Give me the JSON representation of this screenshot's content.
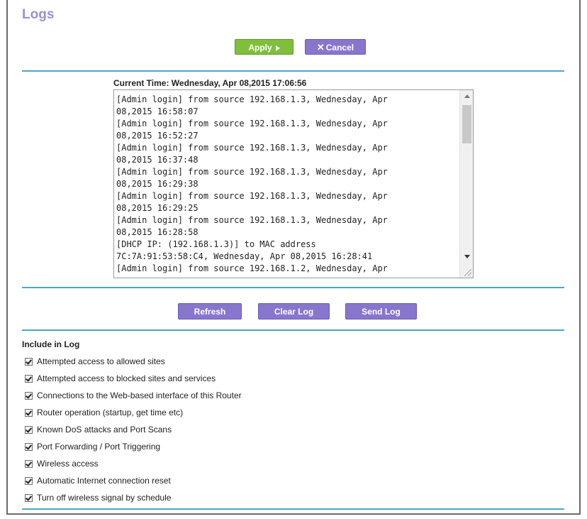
{
  "page": {
    "title": "Logs"
  },
  "actions": {
    "apply_label": "Apply",
    "cancel_label": "Cancel",
    "apply_icon": "arrow-right-icon",
    "cancel_icon": "x-icon"
  },
  "log": {
    "current_time": "Current Time: Wednesday, Apr 08,2015 17:06:56",
    "text": "[Admin login] from source 192.168.1.3, Wednesday, Apr\n08,2015 16:58:07\n[Admin login] from source 192.168.1.3, Wednesday, Apr\n08,2015 16:52:27\n[Admin login] from source 192.168.1.3, Wednesday, Apr\n08,2015 16:37:48\n[Admin login] from source 192.168.1.3, Wednesday, Apr\n08,2015 16:29:38\n[Admin login] from source 192.168.1.3, Wednesday, Apr\n08,2015 16:29:25\n[Admin login] from source 192.168.1.3, Wednesday, Apr\n08,2015 16:28:58\n[DHCP IP: (192.168.1.3)] to MAC address\n7C:7A:91:53:58:C4, Wednesday, Apr 08,2015 16:28:41\n[Admin login] from source 192.168.1.2, Wednesday, Apr"
  },
  "log_actions": {
    "refresh_label": "Refresh",
    "clear_label": "Clear Log",
    "send_label": "Send Log"
  },
  "include": {
    "heading": "Include in Log",
    "options": [
      {
        "label": "Attempted access to allowed sites",
        "checked": true
      },
      {
        "label": "Attempted access to blocked sites and services",
        "checked": true
      },
      {
        "label": "Connections to the Web-based interface of this Router",
        "checked": true
      },
      {
        "label": "Router operation (startup, get time etc)",
        "checked": true
      },
      {
        "label": "Known DoS attacks and Port Scans",
        "checked": true
      },
      {
        "label": "Port Forwarding / Port Triggering",
        "checked": true
      },
      {
        "label": "Wireless access",
        "checked": true
      },
      {
        "label": "Automatic Internet connection reset",
        "checked": true
      },
      {
        "label": "Turn off wireless signal by schedule",
        "checked": true
      }
    ]
  },
  "colors": {
    "title": "#9a8fd6",
    "apply_button": "#7fbf3b",
    "purple_button": "#8876cc",
    "divider": "#4aa8c6"
  }
}
